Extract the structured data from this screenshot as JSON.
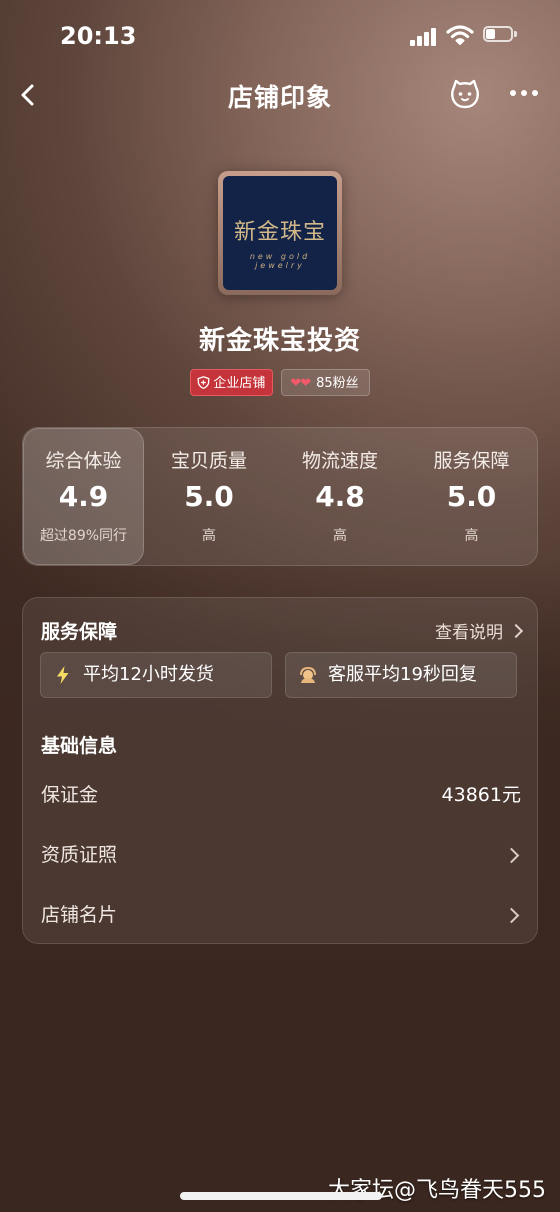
{
  "status_bar": {
    "time": "20:13"
  },
  "nav": {
    "title": "店铺印象"
  },
  "logo": {
    "text_cn": "新金珠宝",
    "text_en": "new gold jewelry"
  },
  "shop": {
    "name": "新金珠宝投资",
    "badge_enterprise": "企业店铺",
    "hearts": "❤❤",
    "fans": "85粉丝"
  },
  "ratings": [
    {
      "label": "综合体验",
      "score": "4.9",
      "sub": "超过89%同行"
    },
    {
      "label": "宝贝质量",
      "score": "5.0",
      "sub": "高"
    },
    {
      "label": "物流速度",
      "score": "4.8",
      "sub": "高"
    },
    {
      "label": "服务保障",
      "score": "5.0",
      "sub": "高"
    }
  ],
  "service": {
    "title": "服务保障",
    "explain": "查看说明",
    "features": [
      {
        "icon": "lightning-icon",
        "text": "平均12小时发货"
      },
      {
        "icon": "customer-service-icon",
        "text": "客服平均19秒回复"
      }
    ]
  },
  "basic": {
    "title": "基础信息",
    "deposit_label": "保证金",
    "deposit_value": "43861元",
    "license_label": "资质证照",
    "card_label": "店铺名片"
  },
  "watermark": "大家坛@飞鸟眷天555",
  "colors": {
    "enterprise_badge": "#c6343b",
    "heart": "#f35b6b",
    "logo_bg": "#132347",
    "logo_gold": "#d3b98a"
  }
}
